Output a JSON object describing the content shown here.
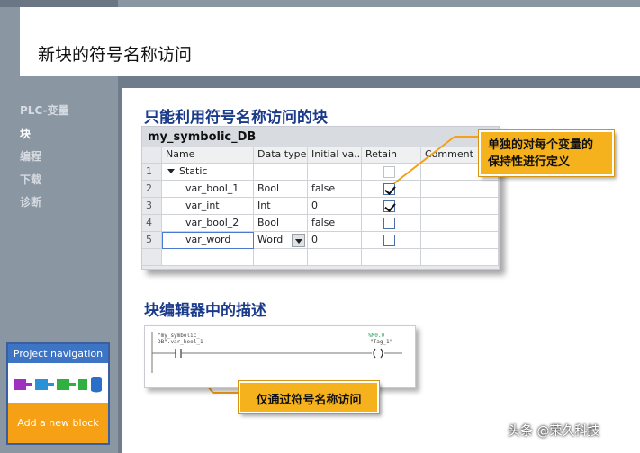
{
  "header": {
    "title": "新块的符号名称访问"
  },
  "sidebar": {
    "items": [
      {
        "label": "PLC-变量",
        "active": false
      },
      {
        "label": "块",
        "active": true
      },
      {
        "label": "编程",
        "active": false
      },
      {
        "label": "下载",
        "active": false
      },
      {
        "label": "诊断",
        "active": false
      }
    ]
  },
  "section1": {
    "title": "只能利用符号名称访问的块"
  },
  "db": {
    "title": "my_symbolic_DB",
    "columns": [
      "Name",
      "Data type",
      "Initial va...",
      "Retain",
      "Comment"
    ],
    "rows": [
      {
        "num": "1",
        "name": "Static",
        "type": "",
        "init": "",
        "retain": "disabled"
      },
      {
        "num": "2",
        "name": "var_bool_1",
        "type": "Bool",
        "init": "false",
        "retain": "checked"
      },
      {
        "num": "3",
        "name": "var_int",
        "type": "Int",
        "init": "0",
        "retain": "checked"
      },
      {
        "num": "4",
        "name": "var_bool_2",
        "type": "Bool",
        "init": "false",
        "retain": "unchecked"
      },
      {
        "num": "5",
        "name": "var_word",
        "type": "Word",
        "init": "0",
        "retain": "unchecked"
      }
    ]
  },
  "callout1": {
    "line1": "单独的对每个变量的",
    "line2": "保持性进行定义"
  },
  "section2": {
    "title": "块编辑器中的描述"
  },
  "ladder": {
    "left_label_1": "\"my_symbolic_",
    "left_label_2": "DB\".var_bool_1",
    "right_addr": "%M0.0",
    "right_tag": "\"Tag_1\""
  },
  "callout2": {
    "text": "仅通过符号名称访问"
  },
  "project_nav": {
    "title": "Project navigation",
    "add_label": "Add a new block"
  },
  "watermark": "头条 @荣久科技",
  "colors": {
    "accent": "#1a3a8a",
    "callout": "#f5b21c",
    "sidebar": "#8b96a3",
    "nav_blue": "#3d74c4",
    "add_orange": "#f5a015"
  }
}
